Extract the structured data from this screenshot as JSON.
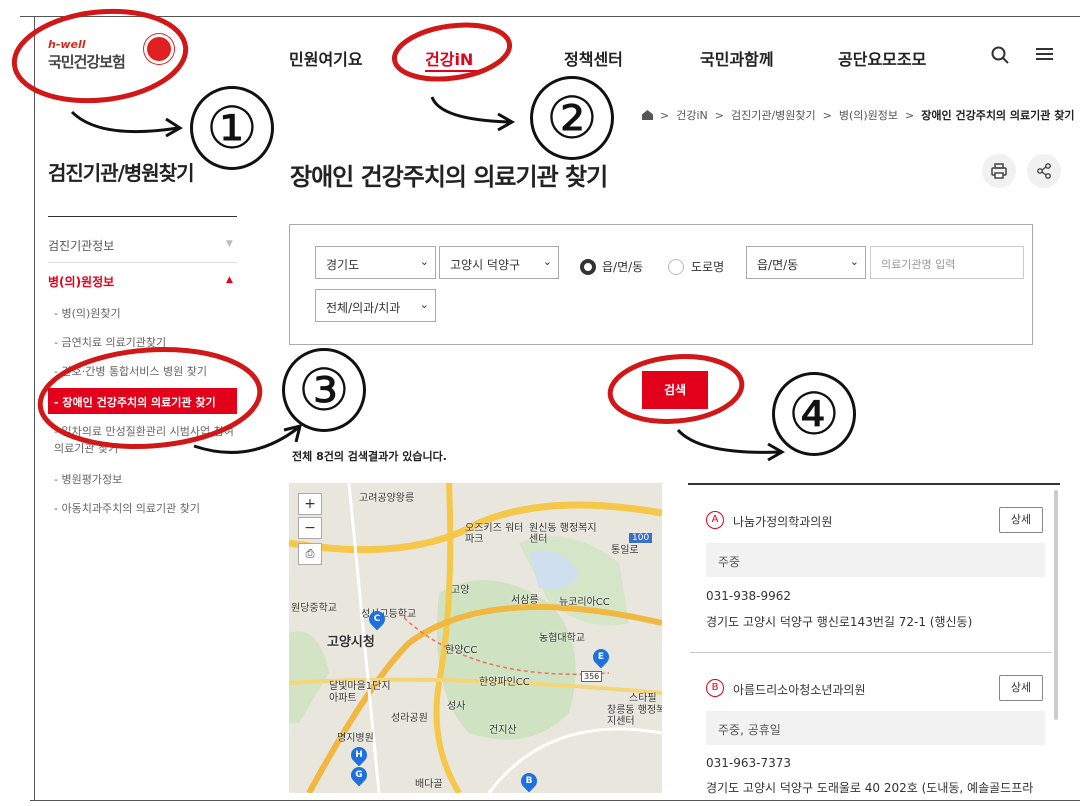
{
  "header": {
    "logo_top": "h-well",
    "logo_main": "국민건강보험",
    "nav": [
      "민원여기요",
      "건강iN",
      "정책센터",
      "국민과함께",
      "공단요모조모"
    ]
  },
  "breadcrumb": [
    "건강iN",
    "검진기관/병원찾기",
    "병(의)원정보",
    "장애인 건강주치의 의료기관 찾기"
  ],
  "sidebar": {
    "title": "검진기관/병원찾기",
    "groups": [
      {
        "label": "검진기관정보",
        "arrow": "▼"
      },
      {
        "label": "병(의)원정보",
        "arrow": "▲"
      }
    ],
    "items": [
      "병(의)원찾기",
      "금연치료 의료기관찾기",
      "간호·간병 통합서비스 병원 찾기",
      "장애인 건강주치의 의료기관 찾기",
      "일차의료 만성질환관리 시범사업 참여의료기관 찾기",
      "병원평가정보",
      "아동치과주치의 의료기관 찾기"
    ]
  },
  "main": {
    "title": "장애인 건강주치의 의료기관 찾기",
    "search": {
      "province": "경기도",
      "district": "고양시 덕양구",
      "radio1": "읍/면/동",
      "radio2": "도로명",
      "town": "읍/면/동",
      "name_placeholder": "의료기관명 입력",
      "type": "전체/의과/치과",
      "button": "검색"
    },
    "result_count": "전체 8건의 검색결과가 있습니다."
  },
  "map": {
    "labels": [
      "고려공양왕릉",
      "오즈키즈 워터파크",
      "원신동 행정복지센터",
      "통일로",
      "고양",
      "서삼릉",
      "뉴코리아CC",
      "농협대학교",
      "원당중학교",
      "성사고등학교",
      "고양시청",
      "한양CC",
      "달빛마을1단지 아파트",
      "한양파인CC",
      "성라공원",
      "명지병원",
      "성사",
      "건지산",
      "창릉동 행정복지센터",
      "스타필",
      "배다골"
    ],
    "road_labels": [
      "100",
      "356"
    ],
    "pins": [
      "C",
      "E",
      "H",
      "G",
      "B"
    ]
  },
  "results": [
    {
      "badge": "A",
      "name": "나눔가정의학과의원",
      "detail": "상세",
      "subject": "주중",
      "phone": "031-938-9962",
      "address": "경기도 고양시 덕양구 행신로143번길 72-1 (행신동)"
    },
    {
      "badge": "B",
      "name": "아름드리소아청소년과의원",
      "detail": "상세",
      "subject": "주중, 공휴일",
      "phone": "031-963-7373",
      "address": "경기도 고양시 덕양구 도래울로 40 202호 (도내동, 예솔골드프라"
    }
  ],
  "annotations": [
    "①",
    "②",
    "③",
    "④"
  ],
  "colors": {
    "accent": "#e3001b",
    "pin": "#1e6fe0",
    "annotation": "#d01818"
  }
}
